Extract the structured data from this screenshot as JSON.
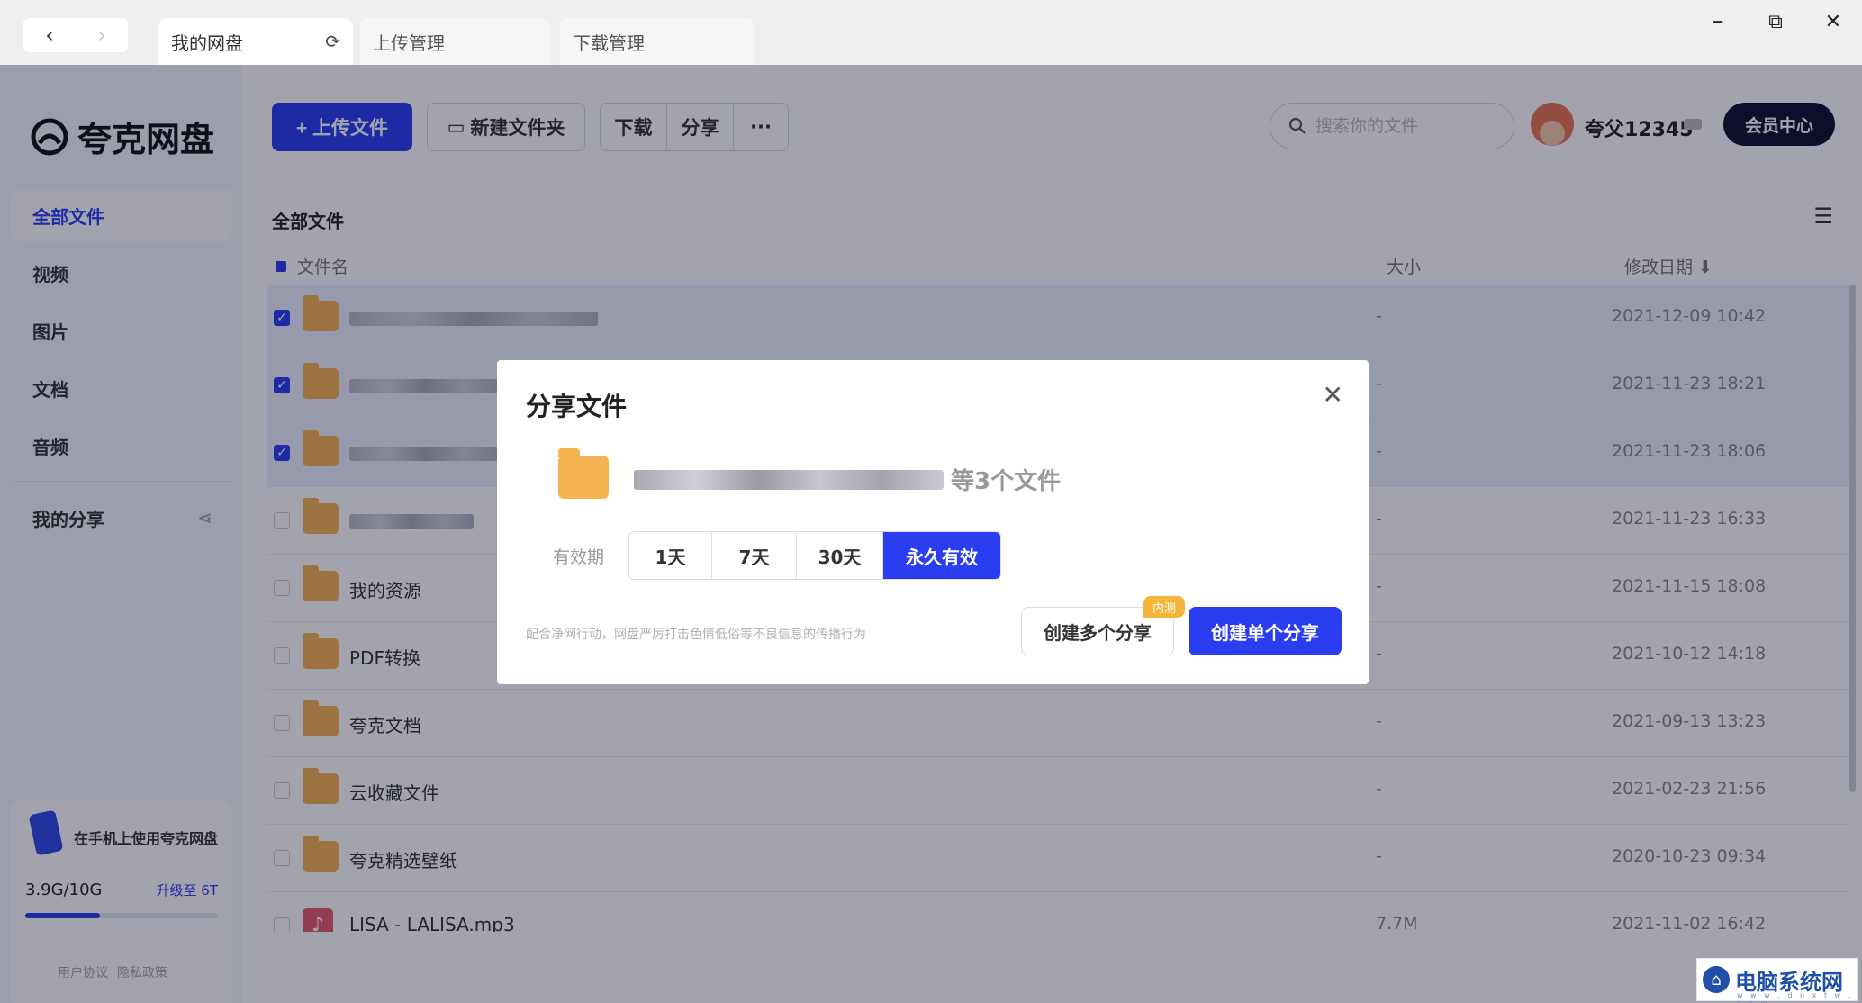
{
  "window": {
    "tabs": [
      {
        "label": "我的网盘"
      },
      {
        "label": "上传管理"
      },
      {
        "label": "下载管理"
      }
    ],
    "back_icon": "‹",
    "forward_icon": "›",
    "reload_icon": "⟳",
    "minimize_icon": "–",
    "restore_icon": "⧉",
    "close_icon": "✕"
  },
  "sidebar": {
    "logo_text": "夸克网盘",
    "items": [
      {
        "label": "全部文件"
      },
      {
        "label": "视频"
      },
      {
        "label": "图片"
      },
      {
        "label": "文档"
      },
      {
        "label": "音频"
      },
      {
        "label": "我的分享"
      }
    ],
    "promo_text": "在手机上使用夸克网盘",
    "storage_used": "3.9G/10G",
    "storage_fraction": 0.39,
    "upgrade_label": "升级至 6T",
    "legal": [
      "用户协议",
      "隐私政策"
    ]
  },
  "toolbar": {
    "upload_label": "+ 上传文件",
    "new_folder_label": "新建文件夹",
    "download_label": "下载",
    "share_label": "分享",
    "more_label": "···",
    "search_placeholder": "搜索你的文件",
    "username": "夸父12345",
    "member_label": "会员中心"
  },
  "filelist": {
    "breadcrumb": "全部文件",
    "columns": {
      "name": "文件名",
      "size": "大小",
      "date": "修改日期 ⬇"
    },
    "rows": [
      {
        "name": "",
        "size": "-",
        "date": "2021-12-09 10:42",
        "checked": true
      },
      {
        "name": "",
        "size": "-",
        "date": "2021-11-23 18:21",
        "checked": true
      },
      {
        "name": "",
        "size": "-",
        "date": "2021-11-23 18:06",
        "checked": true
      },
      {
        "name": "",
        "size": "-",
        "date": "2021-11-23 16:33",
        "checked": false
      },
      {
        "name": "我的资源",
        "size": "-",
        "date": "2021-11-15 18:08",
        "checked": false
      },
      {
        "name": "PDF转换",
        "size": "-",
        "date": "2021-10-12 14:18",
        "checked": false
      },
      {
        "name": "夸克文档",
        "size": "-",
        "date": "2021-09-13 13:23",
        "checked": false
      },
      {
        "name": "云收藏文件",
        "size": "-",
        "date": "2021-02-23 21:56",
        "checked": false
      },
      {
        "name": "夸克精选壁纸",
        "size": "-",
        "date": "2020-10-23 09:34",
        "checked": false
      },
      {
        "name": "LISA - LALISA.mp3",
        "size": "7.7M",
        "date": "2021-11-02 16:42",
        "checked": false
      }
    ]
  },
  "modal": {
    "title": "分享文件",
    "close_icon": "✕",
    "file_count_text": "等3个文件",
    "period_label": "有效期",
    "periods": [
      "1天",
      "7天",
      "30天",
      "永久有效"
    ],
    "selected_period": "永久有效",
    "notice": "配合净网行动，网盘严厉打击色情低俗等不良信息的传播行为",
    "multi_share_label": "创建多个分享",
    "beta_badge": "内测",
    "single_share_label": "创建单个分享"
  },
  "watermark": {
    "text": "电脑系统网",
    "sub": "w w w . d n x t w . c o m"
  }
}
